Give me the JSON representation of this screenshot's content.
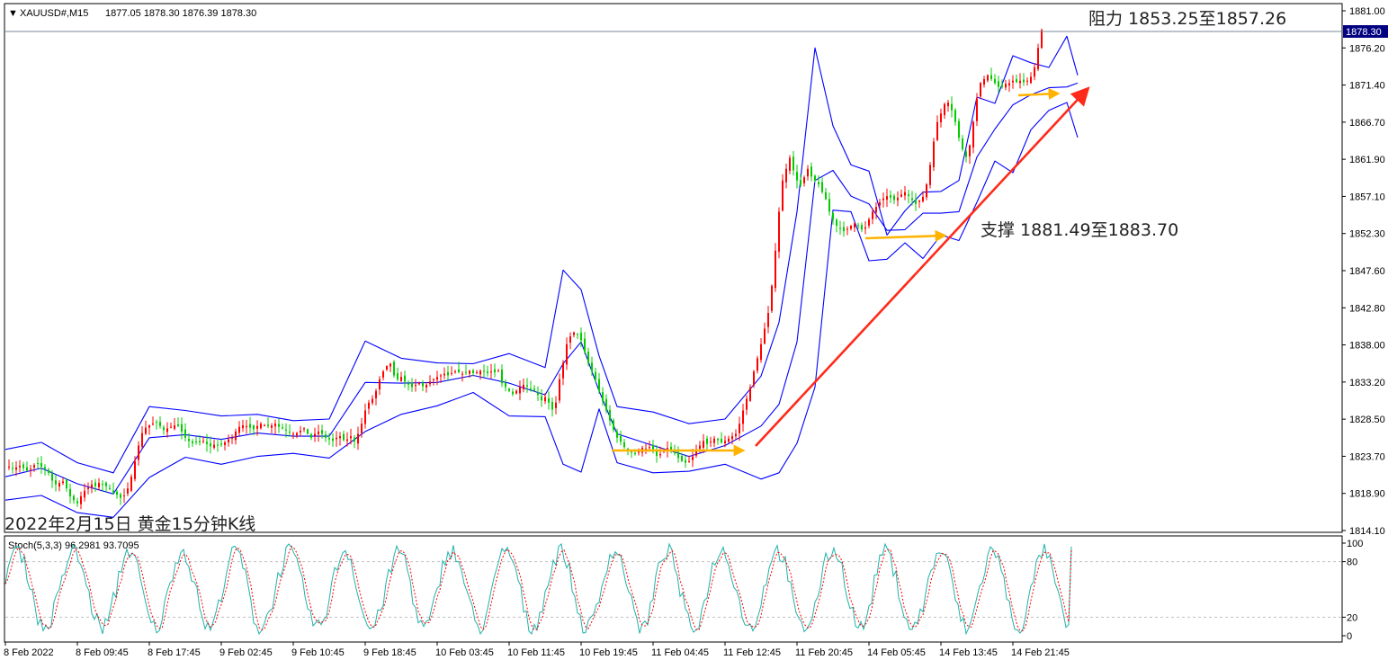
{
  "header": {
    "symbol": "XAUUSD#,M15",
    "ohlc": "1877.05 1878.30 1876.39 1878.30"
  },
  "annotations": {
    "resistance": "阻力 1853.25至1857.26",
    "support": "支撑 1881.49至1883.70",
    "caption": "2022年2月15日 黄金15分钟K线"
  },
  "colors": {
    "bollinger": "#0000ff",
    "bull_candle": "#ff0000",
    "bear_candle": "#00cc00",
    "stoch_main": "#20b2aa",
    "stoch_signal": "#ff0000",
    "trend_arrow": "#ff2a1a",
    "level_arrow": "#ffb300",
    "price_tag_bg": "#000080"
  },
  "chart_data": [
    {
      "type": "candlestick",
      "price_axis_ticks": [
        "1881.00",
        "1876.20",
        "1871.40",
        "1866.70",
        "1861.90",
        "1857.10",
        "1852.30",
        "1847.60",
        "1842.80",
        "1838.00",
        "1833.20",
        "1828.50",
        "1823.70",
        "1818.90",
        "1814.10"
      ],
      "current_price": "1878.30",
      "ylim": [
        1814.1,
        1881.0
      ],
      "time_axis_ticks": [
        "8 Feb 2022",
        "8 Feb 09:45",
        "8 Feb 17:45",
        "9 Feb 02:45",
        "9 Feb 10:45",
        "9 Feb 18:45",
        "10 Feb 03:45",
        "10 Feb 11:45",
        "10 Feb 19:45",
        "11 Feb 04:45",
        "11 Feb 12:45",
        "11 Feb 20:45",
        "14 Feb 05:45",
        "14 Feb 13:45",
        "14 Feb 21:45"
      ],
      "close_path": {
        "x": [
          0,
          4,
          8,
          12,
          16,
          20,
          24,
          28,
          32,
          36,
          40,
          44,
          48,
          52,
          56,
          60,
          64,
          68,
          72,
          76,
          80,
          84,
          88,
          92,
          96,
          100,
          104,
          108,
          112,
          116,
          120,
          124,
          128,
          132,
          136,
          140,
          144,
          148,
          152,
          156,
          160,
          164,
          168,
          172,
          176,
          180,
          184,
          188,
          192,
          196,
          200,
          204,
          208,
          212,
          216,
          220,
          224,
          228,
          232,
          236,
          240,
          244,
          248,
          252,
          256,
          260,
          264,
          268,
          272,
          276,
          280,
          284,
          288,
          292,
          296,
          300,
          304,
          308,
          312,
          316,
          320,
          324,
          328,
          332,
          336,
          340,
          344,
          348,
          352,
          356,
          360,
          364,
          368,
          372,
          376,
          380,
          384,
          388,
          392,
          396,
          400,
          404,
          408,
          412,
          416,
          420,
          424,
          428,
          432,
          436,
          440,
          444,
          448,
          452,
          456,
          460,
          464,
          468,
          472,
          476,
          480,
          484,
          488,
          492,
          496,
          500,
          504,
          508,
          512,
          516,
          520,
          524,
          528,
          532,
          536,
          540,
          544,
          548,
          552,
          556,
          560,
          564,
          568,
          572,
          576,
          580,
          584,
          588,
          592,
          596,
          600,
          604,
          608,
          612,
          616,
          620,
          624,
          628,
          632,
          636,
          640,
          644,
          648,
          652,
          656,
          660,
          664,
          668,
          672,
          676,
          680,
          684,
          688,
          692,
          696,
          700,
          704,
          708,
          712,
          716,
          720,
          724,
          728,
          732,
          736,
          740,
          744,
          748,
          752,
          756,
          760,
          764,
          768,
          772,
          776,
          780,
          784,
          788,
          792,
          796,
          800,
          804,
          808,
          812,
          816,
          820,
          824,
          828,
          832,
          836,
          840,
          844,
          848,
          852,
          856,
          860,
          864,
          868,
          872,
          876,
          880,
          884,
          888,
          892,
          896,
          900,
          904,
          908,
          912,
          916,
          920,
          924,
          928,
          932,
          936,
          940,
          944,
          948,
          952,
          956,
          960,
          964,
          968,
          972,
          976,
          980,
          984,
          988,
          992,
          996,
          1000,
          1004,
          1008,
          1012,
          1016,
          1020,
          1024,
          1028,
          1032,
          1036,
          1040,
          1044,
          1048,
          1052,
          1056,
          1060,
          1064,
          1068,
          1072,
          1076,
          1080,
          1084,
          1088,
          1092,
          1096,
          1100,
          1104,
          1108,
          1112,
          1116,
          1120,
          1124,
          1128,
          1132,
          1136,
          1140,
          1144,
          1148,
          1152,
          1156,
          1160,
          1164,
          1168,
          1172,
          1176,
          1180,
          1184,
          1188
        ],
        "y": [
          1822.5,
          1822.3,
          1822.0,
          1822.2,
          1822.4,
          1822.1,
          1821.8,
          1822.0,
          1822.5,
          1822.7,
          1822.3,
          1822.0,
          1821.5,
          1820.5,
          1820.0,
          1820.2,
          1820.4,
          1819.5,
          1818.5,
          1818.0,
          1817.6,
          1818.5,
          1819.2,
          1819.6,
          1820.0,
          1819.8,
          1820.2,
          1820.0,
          1819.8,
          1819.5,
          1819.0,
          1818.7,
          1818.3,
          1818.6,
          1819.5,
          1821.0,
          1823.0,
          1825.0,
          1826.6,
          1827.3,
          1827.6,
          1827.8,
          1828.0,
          1827.5,
          1827.0,
          1827.2,
          1827.4,
          1827.6,
          1827.5,
          1826.8,
          1826.0,
          1825.6,
          1825.3,
          1825.5,
          1825.4,
          1825.6,
          1825.2,
          1824.9,
          1825.1,
          1825.0,
          1825.1,
          1825.4,
          1825.8,
          1826.0,
          1826.8,
          1827.4,
          1827.6,
          1827.5,
          1827.3,
          1827.1,
          1827.5,
          1827.8,
          1827.6,
          1827.5,
          1827.6,
          1827.8,
          1827.4,
          1827.2,
          1827.0,
          1826.7,
          1826.5,
          1826.6,
          1826.9,
          1827.2,
          1826.5,
          1826.0,
          1826.5,
          1826.8,
          1826.5,
          1826.0,
          1825.8,
          1825.6,
          1826.0,
          1826.2,
          1825.7,
          1825.8,
          1826.2,
          1825.5,
          1826.5,
          1827.8,
          1829.5,
          1830.5,
          1831.0,
          1832.0,
          1833.5,
          1834.5,
          1835.2,
          1835.5,
          1834.0,
          1833.5,
          1833.8,
          1833.2,
          1832.8,
          1832.5,
          1832.8,
          1833.0,
          1832.6,
          1832.8,
          1833.2,
          1833.5,
          1833.8,
          1834.0,
          1834.2,
          1834.0,
          1834.3,
          1834.5,
          1834.4,
          1834.2,
          1834.4,
          1834.6,
          1834.3,
          1834.4,
          1834.6,
          1834.5,
          1834.3,
          1834.5,
          1834.4,
          1834.6,
          1833.0,
          1832.5,
          1832.0,
          1831.6,
          1832.0,
          1832.5,
          1832.8,
          1832.6,
          1832.2,
          1832.0,
          1831.5,
          1830.8,
          1831.2,
          1830.5,
          1829.6,
          1830.5,
          1833.5,
          1835.6,
          1838.0,
          1839.0,
          1839.5,
          1839.3,
          1838.5,
          1837.0,
          1835.6,
          1834.5,
          1833.4,
          1832.0,
          1830.7,
          1829.5,
          1828.2,
          1827.0,
          1826.0,
          1825.5,
          1824.8,
          1824.3,
          1824.1,
          1823.9,
          1824.3,
          1824.7,
          1824.6,
          1824.8,
          1824.2,
          1823.7,
          1823.9,
          1824.5,
          1824.7,
          1824.3,
          1824.0,
          1823.4,
          1823.0,
          1822.8,
          1823.0,
          1823.6,
          1824.5,
          1825.0,
          1825.6,
          1825.2,
          1825.5,
          1825.9,
          1825.7,
          1825.4,
          1825.6,
          1825.9,
          1826.2,
          1826.5,
          1827.8,
          1829.5,
          1831.0,
          1832.5,
          1834.5,
          1836.2,
          1838.0,
          1840.0,
          1842.0,
          1845.5,
          1850.0,
          1855.0,
          1859.0,
          1860.5,
          1861.9,
          1860.3,
          1859.0,
          1858.4,
          1859.4,
          1860.5,
          1859.5,
          1859.0,
          1858.5,
          1857.5,
          1856.6,
          1855.0,
          1854.0,
          1853.2,
          1852.8,
          1852.5,
          1852.8,
          1853.2,
          1853.5,
          1853.2,
          1852.7,
          1853.0,
          1854.0,
          1855.0,
          1855.6,
          1856.2,
          1856.7,
          1857.0,
          1856.8,
          1856.5,
          1856.8,
          1857.2,
          1857.5,
          1857.0,
          1856.5,
          1856.0,
          1856.4,
          1856.9,
          1858.5,
          1861.0,
          1864.0,
          1866.5,
          1867.6,
          1868.8,
          1869.0,
          1868.0,
          1866.5,
          1864.5,
          1863.0,
          1862.0,
          1863.5,
          1866.5,
          1869.5,
          1871.5,
          1872.0,
          1872.5,
          1872.0,
          1871.5,
          1871.0,
          1871.0,
          1871.4,
          1871.5,
          1871.8,
          1871.6,
          1871.8,
          1871.6,
          1871.8,
          1872.3,
          1873.5,
          1876.0,
          1878.3
        ]
      },
      "bollinger_bands": {
        "x": [
          0,
          40,
          80,
          120,
          160,
          200,
          240,
          280,
          320,
          360,
          400,
          440,
          480,
          520,
          560,
          600,
          620,
          640,
          660,
          680,
          720,
          760,
          800,
          840,
          860,
          880,
          900,
          920,
          940,
          960,
          980,
          1000,
          1020,
          1040,
          1060,
          1080,
          1100,
          1120,
          1140,
          1160,
          1180,
          1192
        ],
        "upper": [
          1824.5,
          1825.4,
          1822.8,
          1821.5,
          1830.0,
          1829.5,
          1828.8,
          1829.0,
          1828.2,
          1828.4,
          1838.4,
          1836.2,
          1835.6,
          1835.5,
          1836.8,
          1835.0,
          1847.5,
          1845.0,
          1836.5,
          1830.0,
          1829.3,
          1827.8,
          1828.4,
          1833.9,
          1840.8,
          1855.0,
          1876.0,
          1866.0,
          1861.0,
          1860.2,
          1852.0,
          1855.1,
          1857.5,
          1857.6,
          1859.0,
          1869.7,
          1868.9,
          1875.0,
          1874.1,
          1873.5,
          1877.5,
          1872.5
        ],
        "middle": [
          1821.0,
          1822.1,
          1820.1,
          1818.8,
          1826.0,
          1826.4,
          1825.8,
          1826.6,
          1826.2,
          1826.2,
          1833.1,
          1833.0,
          1833.1,
          1834.0,
          1833.0,
          1831.5,
          1835.5,
          1838.3,
          1832.0,
          1826.5,
          1825.0,
          1823.6,
          1825.0,
          1827.5,
          1830.3,
          1838.3,
          1859.0,
          1860.3,
          1857.0,
          1856.0,
          1852.6,
          1852.7,
          1854.8,
          1854.8,
          1855.0,
          1862.0,
          1865.6,
          1868.7,
          1870.0,
          1870.9,
          1871.0,
          1871.5
        ],
        "lower": [
          1818.0,
          1818.6,
          1816.4,
          1815.8,
          1820.9,
          1823.5,
          1822.6,
          1823.6,
          1824.0,
          1823.4,
          1826.8,
          1829.0,
          1830.1,
          1831.8,
          1828.8,
          1828.7,
          1822.6,
          1821.6,
          1829.7,
          1822.8,
          1821.5,
          1821.7,
          1822.6,
          1820.7,
          1821.5,
          1825.3,
          1832.5,
          1855.2,
          1855.0,
          1848.7,
          1848.9,
          1851.0,
          1849.0,
          1852.0,
          1851.3,
          1856.2,
          1861.5,
          1860.0,
          1865.5,
          1868.0,
          1869.0,
          1864.5
        ]
      }
    },
    {
      "type": "line",
      "name": "Stoch(5,3,3) 96.2981 93.7095",
      "ylim": [
        0,
        100
      ],
      "yticks": [
        "100",
        "80",
        "20",
        "0"
      ],
      "levels": [
        80,
        20
      ],
      "series_note": "oscillating %K (teal) and %D (red dashed) lines"
    }
  ]
}
